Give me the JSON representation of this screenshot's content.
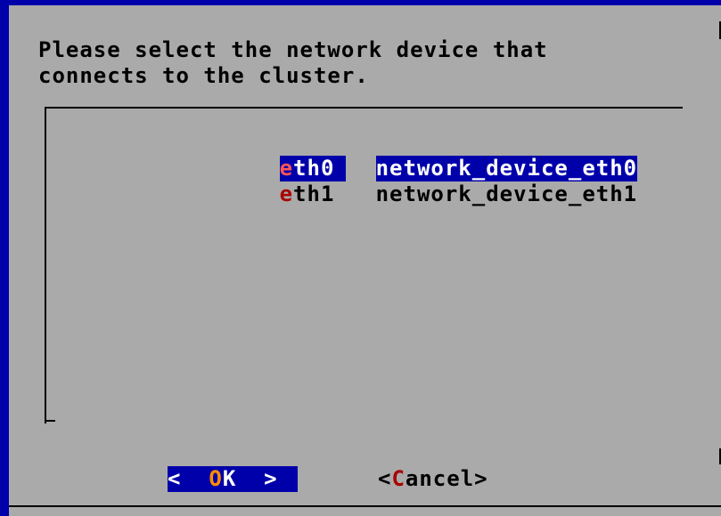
{
  "dialog": {
    "prompt": "Please select the network device that\nconnects to the cluster.",
    "items": [
      {
        "tag_hot": "e",
        "tag_rest": "th0",
        "description": "network_device_eth0",
        "selected": true
      },
      {
        "tag_hot": "e",
        "tag_rest": "th1",
        "description": "network_device_eth1",
        "selected": false
      }
    ],
    "buttons": {
      "ok": {
        "left": "<  ",
        "hot": "O",
        "right": "K  >"
      },
      "cancel": {
        "left": "<",
        "hot": "C",
        "right": "ancel>"
      }
    }
  },
  "colors": {
    "screen_bg": "#0000aa",
    "dialog_bg": "#aaaaaa",
    "selection_bg": "#0000aa",
    "hotkey_red": "#aa0000",
    "hotkey_orange": "#ff8c00"
  }
}
